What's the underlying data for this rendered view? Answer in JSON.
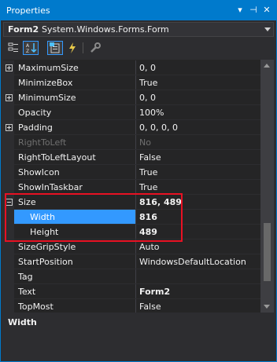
{
  "window": {
    "title": "Properties"
  },
  "title_buttons": {
    "dropdown": "▾",
    "pin": "⊣",
    "close": "✕"
  },
  "object_selector": {
    "name": "Form2",
    "type": "System.Windows.Forms.Form"
  },
  "toolbar": {
    "buttons": [
      {
        "name": "categorized-icon",
        "active": false
      },
      {
        "name": "alphabetical-icon",
        "active": true
      },
      {
        "name": "properties-icon",
        "active": true
      },
      {
        "name": "events-icon",
        "active": false
      },
      {
        "name": "property-pages-icon",
        "active": false
      }
    ]
  },
  "properties": [
    {
      "name": "MaximumSize",
      "value": "0, 0",
      "expander": "plus"
    },
    {
      "name": "MinimizeBox",
      "value": "True"
    },
    {
      "name": "MinimumSize",
      "value": "0, 0",
      "expander": "plus"
    },
    {
      "name": "Opacity",
      "value": "100%"
    },
    {
      "name": "Padding",
      "value": "0, 0, 0, 0",
      "expander": "plus"
    },
    {
      "name": "RightToLeft",
      "value": "No",
      "disabled": true
    },
    {
      "name": "RightToLeftLayout",
      "value": "False"
    },
    {
      "name": "ShowIcon",
      "value": "True"
    },
    {
      "name": "ShowInTaskbar",
      "value": "True"
    },
    {
      "name": "Size",
      "value": "816, 489",
      "expander": "minus",
      "bold": true
    },
    {
      "name": "Width",
      "value": "816",
      "child": true,
      "bold": true,
      "selected": true
    },
    {
      "name": "Height",
      "value": "489",
      "child": true,
      "bold": true
    },
    {
      "name": "SizeGripStyle",
      "value": "Auto"
    },
    {
      "name": "StartPosition",
      "value": "WindowsDefaultLocation"
    },
    {
      "name": "Tag",
      "value": ""
    },
    {
      "name": "Text",
      "value": "Form2",
      "bold": true
    },
    {
      "name": "TopMost",
      "value": "False"
    }
  ],
  "description": {
    "title": "Width"
  },
  "colors": {
    "accent": "#007acc",
    "selection": "#3399ff",
    "highlight_border": "#e81123"
  }
}
